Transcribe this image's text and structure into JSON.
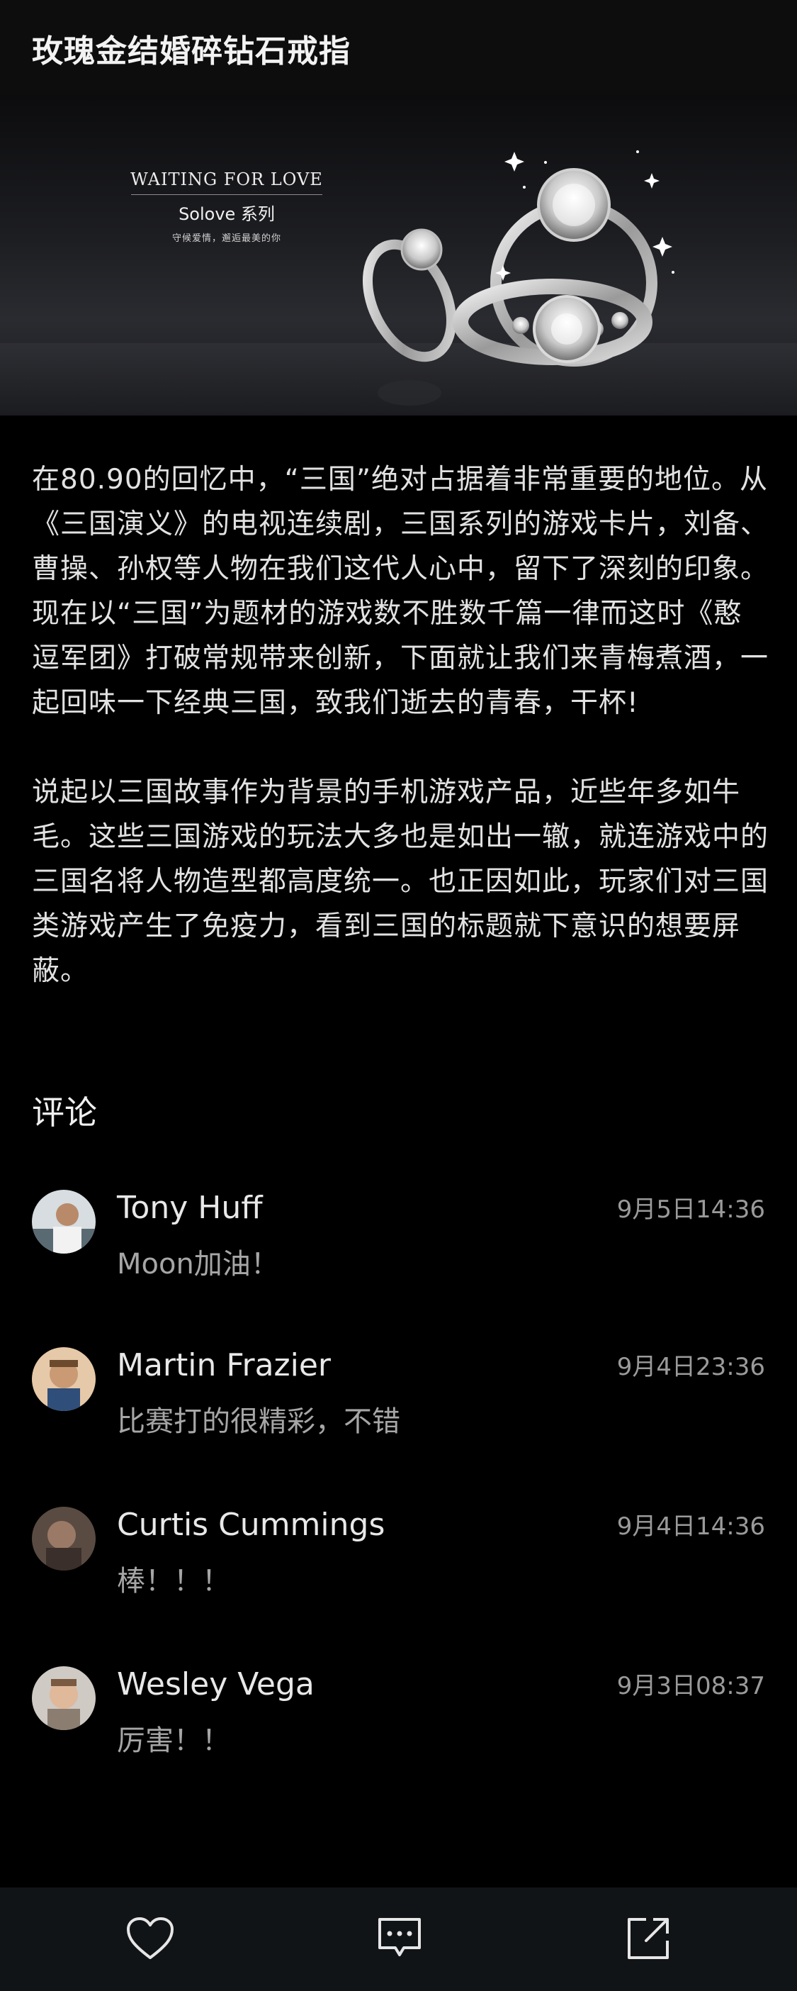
{
  "header": {
    "title": "玫瑰金结婚碎钻石戒指"
  },
  "banner": {
    "heading": "WAITING FOR LOVE",
    "series": "Solove 系列",
    "tagline": "守候爱情，邂逅最美的你"
  },
  "article": {
    "paragraphs": [
      "在80.90的回忆中，“三国”绝对占据着非常重要的地位。从《三国演义》的电视连续剧，三国系列的游戏卡片，刘备、曹操、孙权等人物在我们这代人心中，留下了深刻的印象。现在以“三国”为题材的游戏数不胜数千篇一律而这时《憨逗军团》打破常规带来创新，下面就让我们来青梅煮酒，一起回味一下经典三国，致我们逝去的青春，干杯!",
      "说起以三国故事作为背景的手机游戏产品，近些年多如牛毛。这些三国游戏的玩法大多也是如出一辙，就连游戏中的三国名将人物造型都高度统一。也正因如此，玩家们对三国类游戏产生了免疫力，看到三国的标题就下意识的想要屏蔽。"
    ]
  },
  "comments": {
    "heading": "评论",
    "items": [
      {
        "name": "Tony Huff",
        "time": "9月5日14:36",
        "text": "Moon加油！"
      },
      {
        "name": "Martin Frazier",
        "time": "9月4日23:36",
        "text": "比赛打的很精彩，不错"
      },
      {
        "name": "Curtis Cummings",
        "time": "9月4日14:36",
        "text": "棒！！！"
      },
      {
        "name": "Wesley Vega",
        "time": "9月3日08:37",
        "text": "厉害！！"
      }
    ]
  },
  "toolbar": {
    "icons": [
      "heart-icon",
      "comment-icon",
      "share-icon"
    ]
  },
  "colors": {
    "background": "#000000",
    "header_bg": "#0d0d0d",
    "toolbar_bg": "#111417",
    "text_primary": "#e6e6e6",
    "text_secondary": "#a6a6a6",
    "timestamp": "#9a9a9a"
  }
}
